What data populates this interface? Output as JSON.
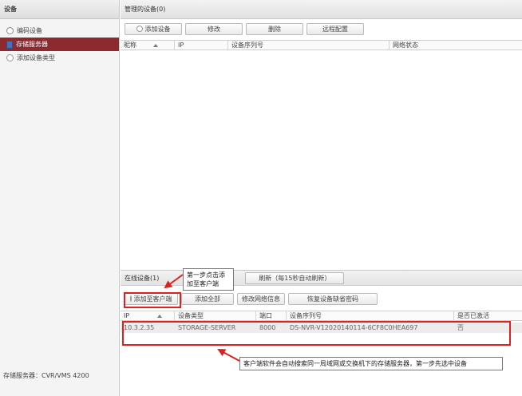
{
  "sidebar": {
    "header": "设备",
    "items": [
      {
        "label": "编码设备",
        "icon": "globe-icon"
      },
      {
        "label": "存储服务器",
        "icon": "server-icon"
      },
      {
        "label": "添加设备类型",
        "icon": "radio-icon"
      }
    ],
    "footer": "存储服务器：CVR/VMS 4200"
  },
  "managed": {
    "title": "管理的设备(0)",
    "toolbar": {
      "add": "添加设备",
      "modify": "修改",
      "delete": "删除",
      "remote_config": "远程配置"
    },
    "columns": [
      "昵称",
      "IP",
      "设备序列号",
      "网络状态"
    ]
  },
  "online": {
    "title": "在线设备(1)",
    "refresh_button": "刷新（每15秒自动刷新）",
    "toolbar": {
      "add_to_client": "添加至客户端",
      "add_all": "添加全部",
      "modify_netinfo": "修改网络信息",
      "restore_password": "恢复设备缺省密码"
    },
    "columns": [
      "IP",
      "设备类型",
      "端口",
      "设备序列号",
      "是否已激活"
    ],
    "rows": [
      {
        "ip": "10.3.2.35",
        "type": "STORAGE-SERVER",
        "port": "8000",
        "serial": "DS-NVR-V12020140114-6CF8C0HEA697",
        "activated": "否"
      }
    ]
  },
  "annotations": {
    "step1": "第一步点击添加至客户端",
    "step0": "客户端软件会自动搜索同一局域网或交换机下的存储服务器，第一步先选中设备"
  },
  "colors": {
    "accent_red": "#e0201c",
    "active_item": "#8c2a30"
  }
}
